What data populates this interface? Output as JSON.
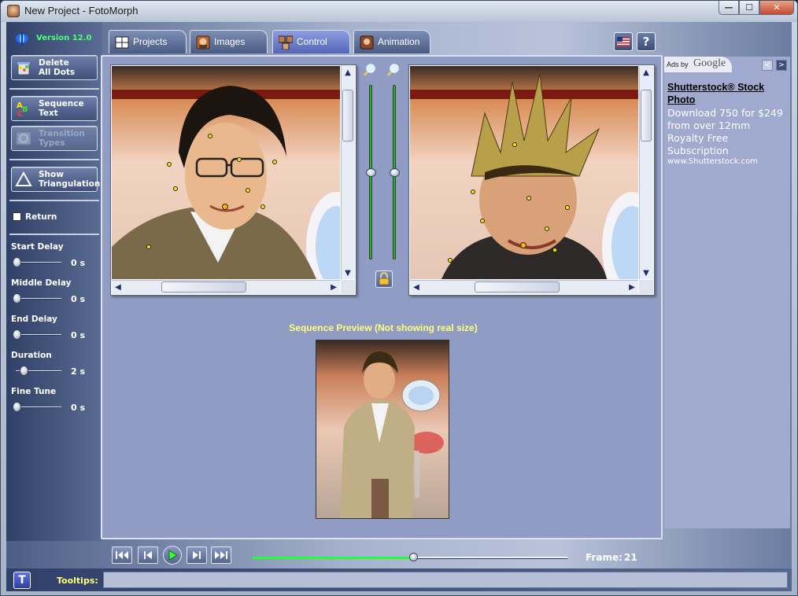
{
  "window": {
    "title": "New Project - FotoMorph",
    "controls": {
      "minimize": "—",
      "maximize": "☐",
      "close": "✕"
    }
  },
  "app": {
    "version": "Version 12.0"
  },
  "tabs": [
    {
      "label": "Projects",
      "icon": "projects-grid-icon",
      "active": false
    },
    {
      "label": "Images",
      "icon": "images-portrait-icon",
      "active": false
    },
    {
      "label": "Control",
      "icon": "control-thumbnails-icon",
      "active": true
    },
    {
      "label": "Animation",
      "icon": "animation-film-icon",
      "active": false
    }
  ],
  "top_buttons": {
    "language": "us-flag-icon",
    "help": "?"
  },
  "left_panel": {
    "delete_dots": "Delete\nAll Dots",
    "sequence_text": "Sequence\nText",
    "transition_types": "Transition\nTypes",
    "show_triangulation": "Show\nTriangulation",
    "return_label": "Return",
    "return_checked": false,
    "controls": [
      {
        "label": "Start Delay",
        "value": "0 s",
        "level": 0.0
      },
      {
        "label": "Middle Delay",
        "value": "0 s",
        "level": 0.0
      },
      {
        "label": "End Delay",
        "value": "0 s",
        "level": 0.0
      },
      {
        "label": "Duration",
        "value": "2 s",
        "level": 0.15
      },
      {
        "label": "Fine Tune",
        "value": "0 s",
        "level": 0.0
      }
    ]
  },
  "main": {
    "preview_title": "Sequence Preview (Not showing real size)",
    "zoom_levels": [
      0.5,
      0.5
    ]
  },
  "ads": {
    "ads_by": "Ads by",
    "google": "Google",
    "title": "Shutterstock® Stock Photo",
    "body": "Download 750 for $249 from over 12mm Royalty Free Subscription",
    "url": "www.Shutterstock.com",
    "prev": "<",
    "next": ">"
  },
  "transport": {
    "frame_label": "Frame:",
    "frame_value": "21",
    "progress": 0.51
  },
  "tooltips": {
    "button": "T",
    "label": "Tooltips:",
    "text": ""
  },
  "colors": {
    "accent_green": "#20ff3a",
    "label_yellow": "#ffff7a",
    "version_green": "#48ff7a",
    "dot_yellow": "#ffe600"
  }
}
